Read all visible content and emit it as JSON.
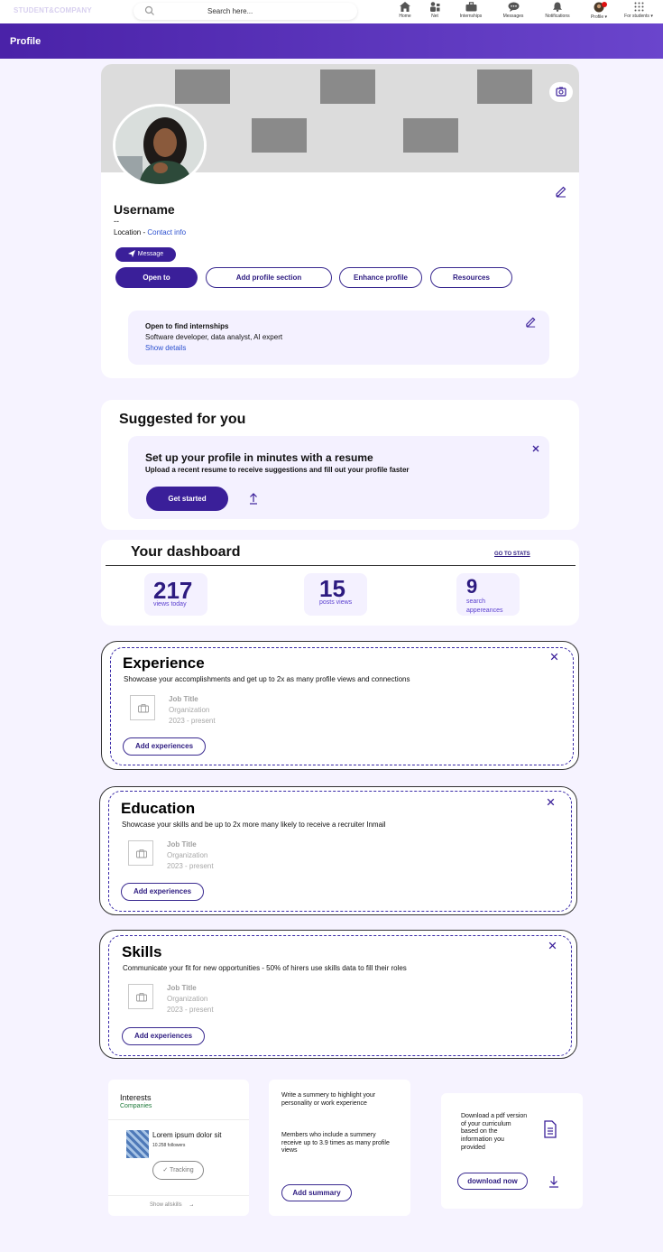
{
  "nav": {
    "brand": "STUDENT&COMPANY",
    "search_placeholder": "Search here...",
    "items": [
      {
        "label": "Home",
        "icon": "home-icon"
      },
      {
        "label": "Net",
        "icon": "network-icon"
      },
      {
        "label": "Internships",
        "icon": "briefcase-icon"
      },
      {
        "label": "Messages",
        "icon": "messages-icon"
      },
      {
        "label": "Notifications",
        "icon": "bell-icon"
      },
      {
        "label": "Profile",
        "icon": "avatar-icon"
      },
      {
        "label": "For students",
        "icon": "grid-icon"
      }
    ]
  },
  "header": {
    "title": "Profile"
  },
  "profile": {
    "username": "Username",
    "dashes": "--",
    "location": "Location -",
    "contact_info": "Contact info",
    "message_button": "Message",
    "buttons": [
      "Open to",
      "Add profile section",
      "Enhance profile",
      "Resources"
    ],
    "open_to": {
      "title": "Open to find internships",
      "roles": "Software developer, data analyst, AI expert",
      "show_details": "Show details"
    }
  },
  "suggested": {
    "title": "Suggested for you",
    "headline": "Set up your profile in minutes with a resume",
    "subline": "Upload a recent resume to receive suggestions and fill out your profile faster",
    "cta": "Get started"
  },
  "dashboard": {
    "title": "Your dashboard",
    "link": "GO TO STATS",
    "stats": [
      {
        "value": "217",
        "label": "views today"
      },
      {
        "value": "15",
        "label": "posts views"
      },
      {
        "value": "9",
        "label": "search",
        "label2": "appereances"
      }
    ]
  },
  "sections": [
    {
      "title": "Experience",
      "desc": "Showcase your accomplishments and get up to 2x as many profile views and connections",
      "job_title": "Job Title",
      "org": "Organization",
      "period": "2023 - present",
      "button": "Add experiences"
    },
    {
      "title": "Education",
      "desc": "Showcase your skills and be up to 2x more many likely to receive a recruiter Inmail",
      "job_title": "Job Title",
      "org": "Organization",
      "period": "2023 - present",
      "button": "Add experiences"
    },
    {
      "title": "Skills",
      "desc": "Communicate your fit for new opportunities - 50% of hirers use skills data to fill their roles",
      "job_title": "Job Title",
      "org": "Organization",
      "period": "2023 - present",
      "button": "Add experiences"
    }
  ],
  "interests": {
    "title": "Interests",
    "tab": "Companies",
    "company_name": "Lorem ipsum dolor sit",
    "followers": "10.258 followers",
    "tracking": "Tracking",
    "show_all": "Show allskills"
  },
  "summary": {
    "line1": "Write a summery to highlight your personality or work experience",
    "line2": "Members who include a summery receive up to 3.9 times as many profile views",
    "button": "Add summary"
  },
  "download": {
    "text": "Download a pdf version of your curriculum based on the information you provided",
    "button": "download now"
  },
  "colors": {
    "primary": "#3a1f99",
    "header_start": "#4a22a8",
    "header_end": "#6a45cc",
    "page_bg": "#f6f3ff"
  }
}
